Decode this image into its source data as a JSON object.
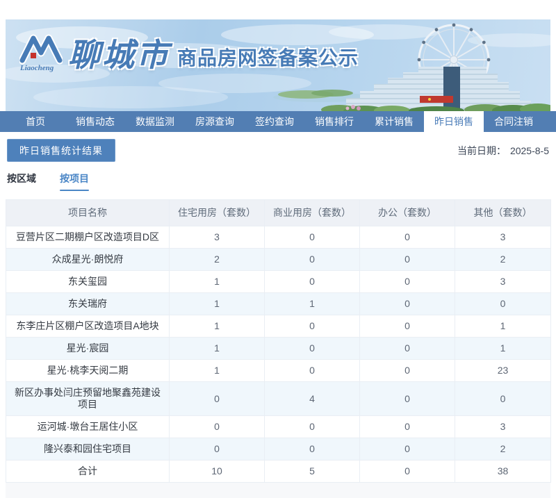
{
  "banner": {
    "brand_script": "Liaocheng",
    "brand_name": "聊城市",
    "title": "商品房网签备案公示"
  },
  "nav": {
    "items": [
      {
        "id": "home",
        "label": "首页",
        "active": false
      },
      {
        "id": "sales-dynamics",
        "label": "销售动态",
        "active": false
      },
      {
        "id": "data-monitor",
        "label": "数据监测",
        "active": false
      },
      {
        "id": "listing-query",
        "label": "房源查询",
        "active": false
      },
      {
        "id": "signing-query",
        "label": "签约查询",
        "active": false
      },
      {
        "id": "sales-ranking",
        "label": "销售排行",
        "active": false
      },
      {
        "id": "cumulative-sales",
        "label": "累计销售",
        "active": false
      },
      {
        "id": "yesterday-sales",
        "label": "昨日销售",
        "active": true
      },
      {
        "id": "contract-cancel",
        "label": "合同注销",
        "active": false
      }
    ]
  },
  "toolbar": {
    "result_button": "昨日销售统计结果",
    "date_label": "当前日期：",
    "date_value": "2025-8-5"
  },
  "view_tabs": [
    {
      "id": "by-district",
      "label": "按区域",
      "active": false
    },
    {
      "id": "by-project",
      "label": "按项目",
      "active": true
    }
  ],
  "table": {
    "headers": [
      "项目名称",
      "住宅用房（套数）",
      "商业用房（套数）",
      "办公（套数）",
      "其他（套数）"
    ],
    "rows": [
      {
        "name": "豆营片区二期棚户区改造项目D区",
        "values": [
          "3",
          "0",
          "0",
          "3"
        ]
      },
      {
        "name": "众成星光·朗悦府",
        "values": [
          "2",
          "0",
          "0",
          "2"
        ]
      },
      {
        "name": "东关玺园",
        "values": [
          "1",
          "0",
          "0",
          "3"
        ]
      },
      {
        "name": "东关瑞府",
        "values": [
          "1",
          "1",
          "0",
          "0"
        ]
      },
      {
        "name": "东李庄片区棚户区改造项目A地块",
        "values": [
          "1",
          "0",
          "0",
          "1"
        ]
      },
      {
        "name": "星光·宸园",
        "values": [
          "1",
          "0",
          "0",
          "1"
        ]
      },
      {
        "name": "星光·桃李天阅二期",
        "values": [
          "1",
          "0",
          "0",
          "23"
        ]
      },
      {
        "name": "新区办事处闫庄预留地聚鑫苑建设项目",
        "values": [
          "0",
          "4",
          "0",
          "0"
        ]
      },
      {
        "name": "运河城·墩台王居住小区",
        "values": [
          "0",
          "0",
          "0",
          "3"
        ]
      },
      {
        "name": "隆兴泰和园住宅项目",
        "values": [
          "0",
          "0",
          "0",
          "2"
        ]
      },
      {
        "name": "合计",
        "values": [
          "10",
          "5",
          "0",
          "38"
        ]
      }
    ]
  },
  "colors": {
    "nav_bg": "#527eb3",
    "accent_blue": "#4a7cb8",
    "button_bg": "#4e81bb",
    "table_header_bg": "#eef1f6",
    "stripe_bg": "#f0f7fc",
    "border": "#e9eef4",
    "logo_red": "#c5322b"
  }
}
